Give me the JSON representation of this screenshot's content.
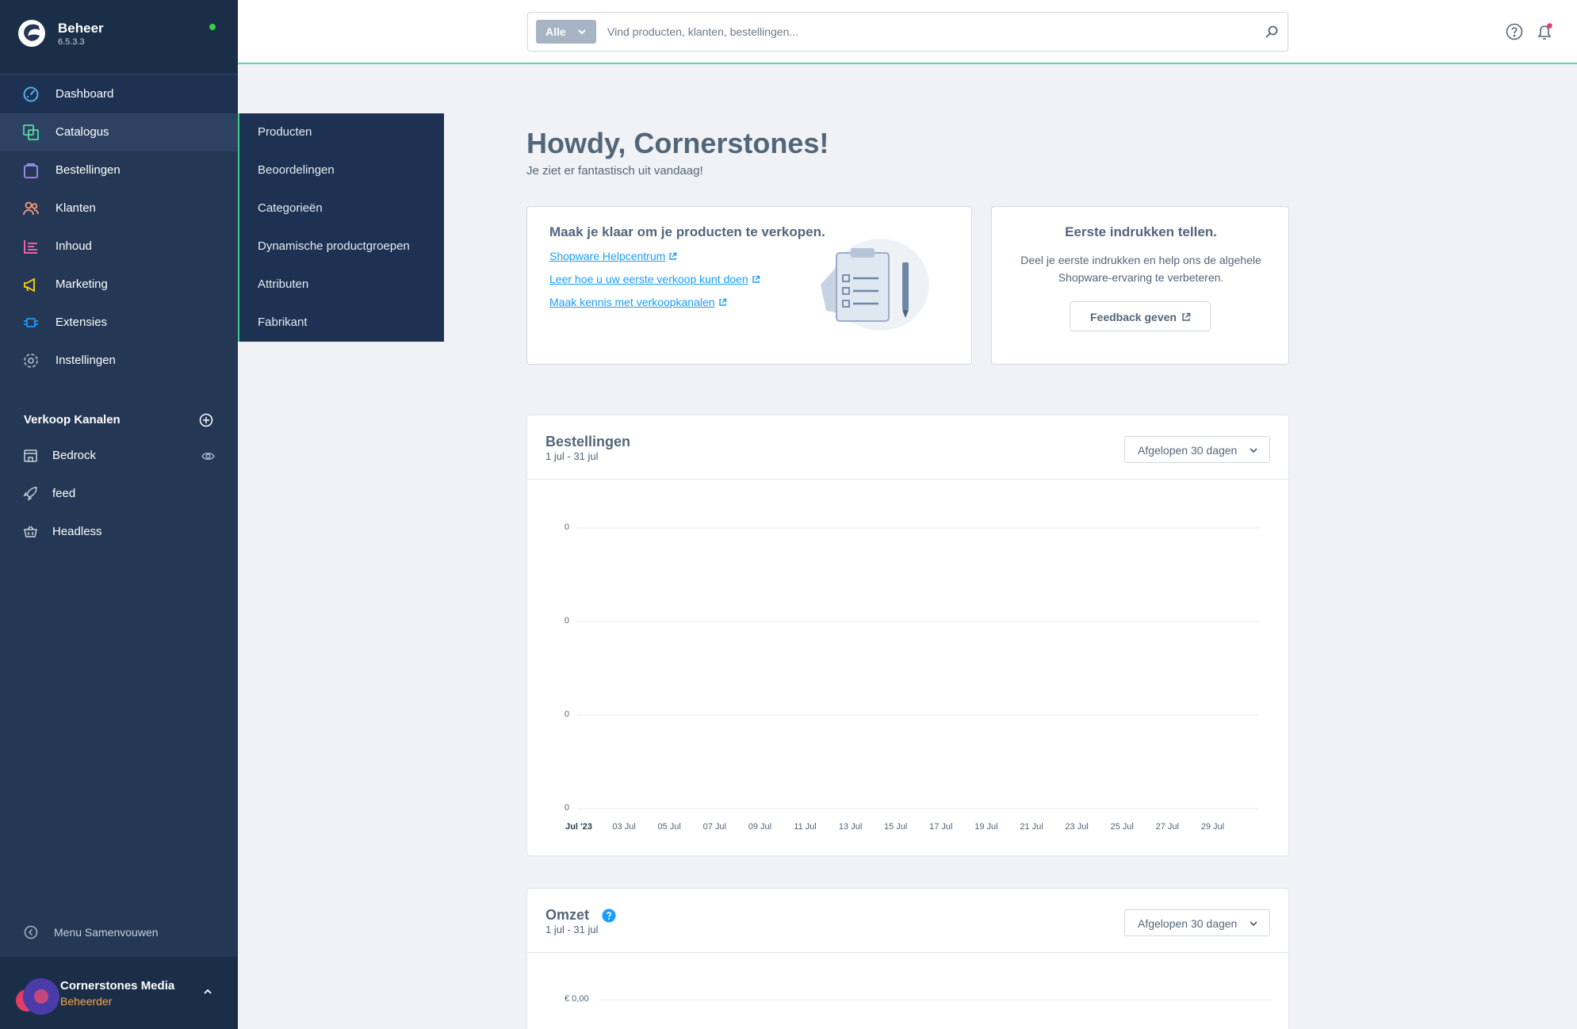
{
  "app": {
    "title": "Beheer",
    "version": "6.5.3.3"
  },
  "nav": [
    {
      "label": "Dashboard",
      "icon": "dashboard-icon"
    },
    {
      "label": "Catalogus",
      "icon": "catalog-icon"
    },
    {
      "label": "Bestellingen",
      "icon": "orders-icon"
    },
    {
      "label": "Klanten",
      "icon": "customers-icon"
    },
    {
      "label": "Inhoud",
      "icon": "content-icon"
    },
    {
      "label": "Marketing",
      "icon": "marketing-icon"
    },
    {
      "label": "Extensies",
      "icon": "extensions-icon"
    },
    {
      "label": "Instellingen",
      "icon": "settings-icon"
    }
  ],
  "catalog_flyout": [
    "Producten",
    "Beoordelingen",
    "Categorieën",
    "Dynamische productgroepen",
    "Attributen",
    "Fabrikant"
  ],
  "sales_channels": {
    "heading": "Verkoop Kanalen",
    "items": [
      {
        "label": "Bedrock",
        "icon": "storefront-icon"
      },
      {
        "label": "feed",
        "icon": "rocket-icon"
      },
      {
        "label": "Headless",
        "icon": "basket-icon"
      }
    ]
  },
  "collapse_label": "Menu Samenvouwen",
  "user": {
    "name": "Cornerstones Media",
    "role": "Beheerder"
  },
  "search": {
    "type_label": "Alle",
    "placeholder": "Vind producten, klanten, bestellingen..."
  },
  "greeting": {
    "title": "Howdy, Cornerstones!",
    "subtitle": "Je ziet er fantastisch uit vandaag!"
  },
  "ready_card": {
    "title": "Maak je klaar om je producten te verkopen.",
    "links": [
      "Shopware Helpcentrum",
      "Leer hoe u uw eerste verkoop kunt doen",
      "Maak kennis met verkoopkanalen"
    ]
  },
  "feedback_card": {
    "title": "Eerste indrukken tellen.",
    "text": "Deel je eerste indrukken en help ons de algehele Shopware-ervaring te verbeteren.",
    "button": "Feedback geven"
  },
  "orders_card": {
    "title": "Bestellingen",
    "range": "1 jul - 31 jul",
    "select": "Afgelopen 30 dagen"
  },
  "revenue_card": {
    "title": "Omzet",
    "range": "1 jul - 31 jul",
    "select": "Afgelopen 30 dagen",
    "first_tick": "€ 0,00"
  },
  "colors": {
    "sidebar": "#243754",
    "accent": "#189eff",
    "active_border": "#3ec88b",
    "online": "#37d046",
    "role": "#f7a84b"
  },
  "chart_data": {
    "type": "line",
    "title": "Bestellingen",
    "subtitle": "1 jul - 31 jul",
    "x_ticks": [
      "Jul '23",
      "03 Jul",
      "05 Jul",
      "07 Jul",
      "09 Jul",
      "11 Jul",
      "13 Jul",
      "15 Jul",
      "17 Jul",
      "19 Jul",
      "21 Jul",
      "23 Jul",
      "25 Jul",
      "27 Jul",
      "29 Jul"
    ],
    "y_ticks": [
      "0",
      "0",
      "0",
      "0"
    ],
    "series": [
      {
        "values": []
      }
    ],
    "grid": true
  }
}
